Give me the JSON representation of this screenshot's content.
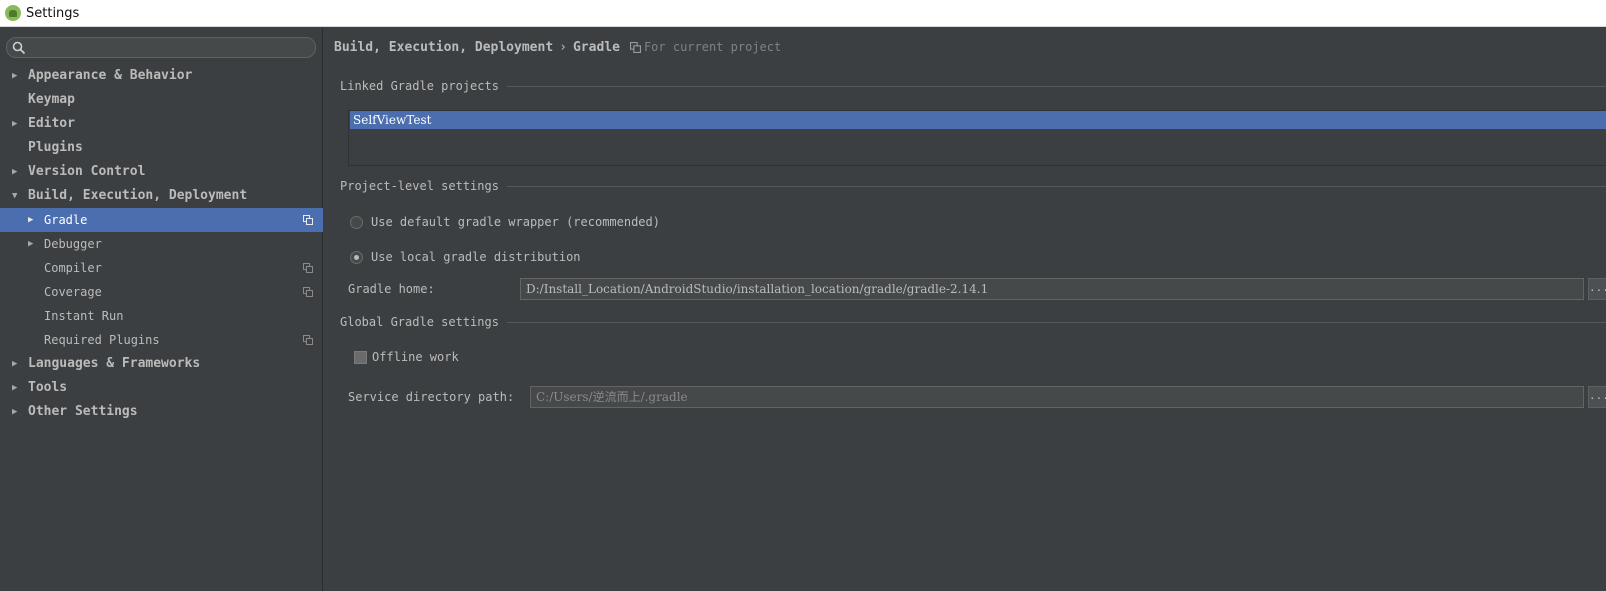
{
  "window": {
    "title": "Settings"
  },
  "search": {
    "placeholder": "",
    "value": ""
  },
  "sidebar": {
    "items": [
      {
        "label": "Appearance & Behavior",
        "expandable": true
      },
      {
        "label": "Keymap",
        "expandable": false
      },
      {
        "label": "Editor",
        "expandable": true
      },
      {
        "label": "Plugins",
        "expandable": false
      },
      {
        "label": "Version Control",
        "expandable": true
      },
      {
        "label": "Build, Execution, Deployment",
        "expandable": true,
        "expanded": true
      },
      {
        "label": "Gradle",
        "expandable": true,
        "selected": true
      },
      {
        "label": "Debugger",
        "expandable": true
      },
      {
        "label": "Compiler",
        "expandable": false
      },
      {
        "label": "Coverage",
        "expandable": false
      },
      {
        "label": "Instant Run",
        "expandable": false
      },
      {
        "label": "Required Plugins",
        "expandable": false
      },
      {
        "label": "Languages & Frameworks",
        "expandable": true
      },
      {
        "label": "Tools",
        "expandable": true
      },
      {
        "label": "Other Settings",
        "expandable": true
      }
    ]
  },
  "breadcrumb": {
    "parent": "Build, Execution, Deployment",
    "separator": "›",
    "current": "Gradle",
    "note": "For current project"
  },
  "linked_projects": {
    "title": "Linked Gradle projects",
    "items": [
      "SelfViewTest"
    ]
  },
  "project_settings": {
    "title": "Project-level settings",
    "option_wrapper": "Use default gradle wrapper (recommended)",
    "option_local": "Use local gradle distribution",
    "selected_option": "local",
    "gradle_home_label": "Gradle home:",
    "gradle_home_value": "D:/Install_Location/AndroidStudio/installation_location/gradle/gradle-2.14.1",
    "browse_label": "..."
  },
  "global_settings": {
    "title": "Global Gradle settings",
    "offline_label": "Offline work",
    "offline_checked": false,
    "service_dir_label": "Service directory path:",
    "service_dir_value": "C:/Users/逆流而上/.gradle",
    "browse_label": "..."
  },
  "colors": {
    "background": "#3c3f41",
    "selection": "#4b6eaf",
    "text": "#bbbbbb"
  }
}
